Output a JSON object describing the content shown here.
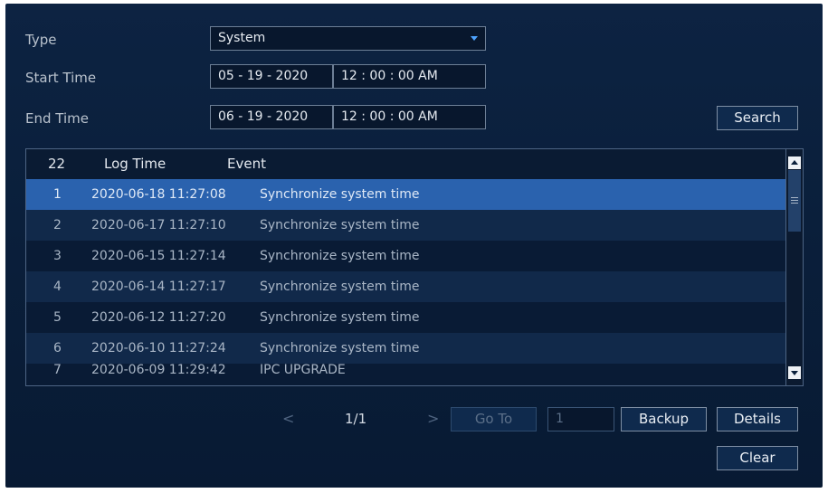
{
  "filters": {
    "type_label": "Type",
    "type_value": "System",
    "start_label": "Start Time",
    "start_date": "05 - 19 - 2020",
    "start_time": "12 : 00 : 00 AM",
    "end_label": "End Time",
    "end_date": "06 - 19 - 2020",
    "end_time": "12 : 00 : 00 AM",
    "search_button": "Search"
  },
  "table": {
    "count": "22",
    "col_log_time": "Log Time",
    "col_event": "Event",
    "rows": [
      {
        "index": "1",
        "time": "2020-06-18 11:27:08",
        "event": "Synchronize system time"
      },
      {
        "index": "2",
        "time": "2020-06-17 11:27:10",
        "event": "Synchronize system time"
      },
      {
        "index": "3",
        "time": "2020-06-15 11:27:14",
        "event": "Synchronize system time"
      },
      {
        "index": "4",
        "time": "2020-06-14 11:27:17",
        "event": "Synchronize system time"
      },
      {
        "index": "5",
        "time": "2020-06-12 11:27:20",
        "event": "Synchronize system time"
      },
      {
        "index": "6",
        "time": "2020-06-10 11:27:24",
        "event": "Synchronize system time"
      },
      {
        "index": "7",
        "time": "2020-06-09 11:29:42",
        "event": "IPC UPGRADE"
      }
    ]
  },
  "pager": {
    "prev": "<",
    "page": "1/1",
    "next": ">",
    "goto_button": "Go To",
    "goto_value": "1"
  },
  "actions": {
    "backup": "Backup",
    "details": "Details",
    "clear": "Clear"
  },
  "icons": {
    "dropdown": "chevron-down-icon",
    "scroll_up": "arrow-up-icon",
    "scroll_down": "arrow-down-icon",
    "grip": "menu-grip-icon"
  },
  "colors": {
    "background": "#0a1f3b",
    "selected_row": "#2a62ae",
    "accent": "#4da3ff"
  }
}
